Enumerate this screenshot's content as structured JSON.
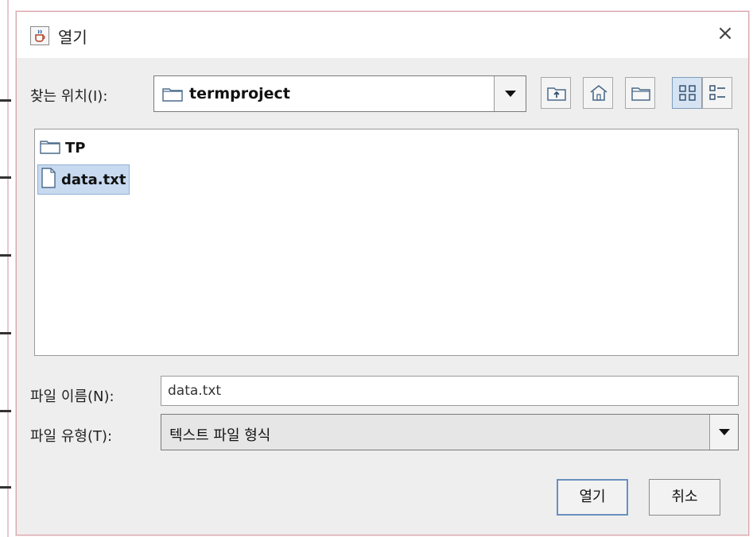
{
  "window": {
    "title": "열기",
    "close_glyph": "×",
    "app_icon": "java-coffee-icon"
  },
  "toolbar": {
    "look_in_label": "찾는 위치(I):",
    "look_in_value": "termproject",
    "buttons": [
      {
        "icon": "up-one-level-icon"
      },
      {
        "icon": "home-icon"
      },
      {
        "icon": "new-folder-icon"
      },
      {
        "icon": "list-view-icon",
        "active": true
      },
      {
        "icon": "details-view-icon"
      }
    ]
  },
  "files": [
    {
      "name": "TP",
      "type": "folder",
      "selected": false
    },
    {
      "name": "data.txt",
      "type": "file",
      "selected": true
    }
  ],
  "file_name": {
    "label": "파일 이름(N):",
    "value": "data.txt"
  },
  "file_type": {
    "label": "파일 유형(T):",
    "value": "텍스트 파일 형식"
  },
  "buttons": {
    "open": "열기",
    "cancel": "취소"
  },
  "colors": {
    "dialog_bg": "#eeeeee",
    "selection": "#c8daf0",
    "border_accent": "#d9a8b0"
  }
}
